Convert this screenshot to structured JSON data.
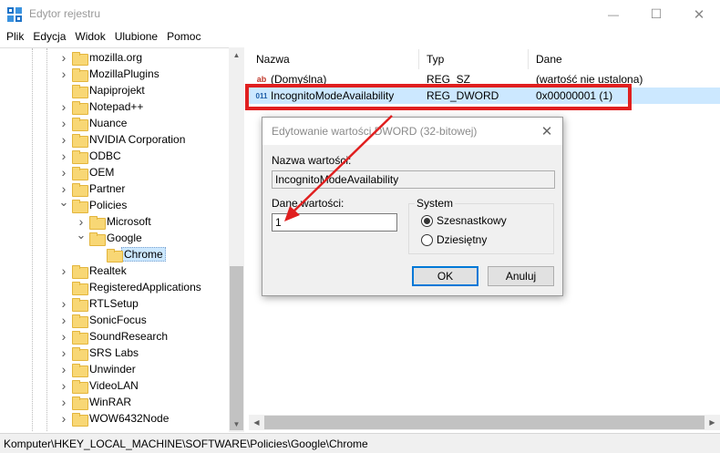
{
  "window": {
    "title": "Edytor rejestru",
    "minimize_glyph": "—",
    "maximize_glyph": "☐",
    "close_glyph": "✕"
  },
  "menu": [
    "Plik",
    "Edycja",
    "Widok",
    "Ulubione",
    "Pomoc"
  ],
  "tree": {
    "items": [
      {
        "label": "mozilla.org",
        "expandable": true,
        "depth": 0
      },
      {
        "label": "MozillaPlugins",
        "expandable": true,
        "depth": 0
      },
      {
        "label": "Napiprojekt",
        "expandable": false,
        "depth": 0
      },
      {
        "label": "Notepad++",
        "expandable": true,
        "depth": 0
      },
      {
        "label": "Nuance",
        "expandable": true,
        "depth": 0
      },
      {
        "label": "NVIDIA Corporation",
        "expandable": true,
        "depth": 0
      },
      {
        "label": "ODBC",
        "expandable": true,
        "depth": 0
      },
      {
        "label": "OEM",
        "expandable": true,
        "depth": 0
      },
      {
        "label": "Partner",
        "expandable": true,
        "depth": 0
      },
      {
        "label": "Policies",
        "expandable": true,
        "expanded": true,
        "depth": 0
      },
      {
        "label": "Microsoft",
        "expandable": true,
        "depth": 1
      },
      {
        "label": "Google",
        "expandable": true,
        "expanded": true,
        "depth": 1
      },
      {
        "label": "Chrome",
        "expandable": false,
        "depth": 2,
        "selected": true
      },
      {
        "label": "Realtek",
        "expandable": true,
        "depth": 0
      },
      {
        "label": "RegisteredApplications",
        "expandable": false,
        "depth": 0
      },
      {
        "label": "RTLSetup",
        "expandable": true,
        "depth": 0
      },
      {
        "label": "SonicFocus",
        "expandable": true,
        "depth": 0
      },
      {
        "label": "SoundResearch",
        "expandable": true,
        "depth": 0
      },
      {
        "label": "SRS Labs",
        "expandable": true,
        "depth": 0
      },
      {
        "label": "Unwinder",
        "expandable": true,
        "depth": 0
      },
      {
        "label": "VideoLAN",
        "expandable": true,
        "depth": 0
      },
      {
        "label": "WinRAR",
        "expandable": true,
        "depth": 0
      },
      {
        "label": "WOW6432Node",
        "expandable": true,
        "depth": 0
      }
    ]
  },
  "values": {
    "columns": [
      "Nazwa",
      "Typ",
      "Dane"
    ],
    "rows": [
      {
        "icon": "string-value-icon",
        "icon_text": "ab",
        "name": "(Domyślna)",
        "type": "REG_SZ",
        "data": "(wartość nie ustalona)"
      },
      {
        "icon": "binary-value-icon",
        "icon_text": "011",
        "name": "IncognitoModeAvailability",
        "type": "REG_DWORD",
        "data": "0x00000001 (1)"
      }
    ]
  },
  "dialog": {
    "title": "Edytowanie wartości DWORD (32-bitowej)",
    "value_name_label": "Nazwa wartości:",
    "value_name": "IncognitoModeAvailability",
    "value_data_label": "Dane wartości:",
    "value_data": "1",
    "system_label": "System",
    "radio_hex": "Szesnastkowy",
    "radio_dec": "Dziesiętny",
    "selected_base": "hex",
    "ok_label": "OK",
    "cancel_label": "Anuluj",
    "close_glyph": "✕"
  },
  "status_path": "Komputer\\HKEY_LOCAL_MACHINE\\SOFTWARE\\Policies\\Google\\Chrome",
  "colors": {
    "highlight": "#cce8ff",
    "annotation": "#e01f1f",
    "folder": "#f8d775"
  }
}
